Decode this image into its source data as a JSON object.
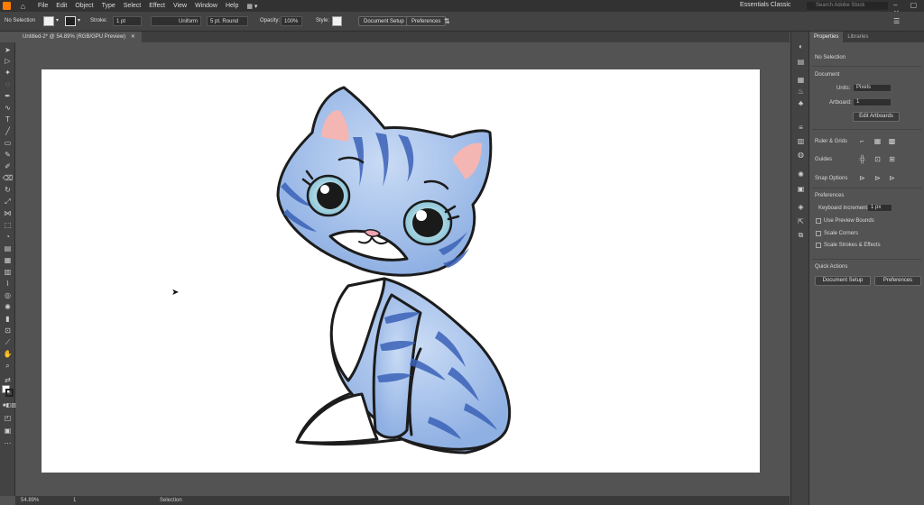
{
  "menubar": {
    "items": [
      "File",
      "Edit",
      "Object",
      "Type",
      "Select",
      "Effect",
      "View",
      "Window",
      "Help"
    ],
    "workspace": "Essentials Classic",
    "search_placeholder": "Search Adobe Stock"
  },
  "control": {
    "selection": "No Selection",
    "stroke_label": "Stroke:",
    "stroke_value": "1 pt",
    "profile": "Uniform",
    "brush": "5 pt. Round",
    "opacity_label": "Opacity:",
    "opacity_value": "100%",
    "style_label": "Style:",
    "doc_setup": "Document Setup",
    "preferences": "Preferences"
  },
  "document": {
    "tab_title": "Untitled-2* @ 54.89% (RGB/GPU Preview)"
  },
  "status": {
    "zoom": "54.89%",
    "artboard": "1",
    "tool": "Selection"
  },
  "panel": {
    "tabs": [
      "Properties",
      "Libraries"
    ],
    "selection": "No Selection",
    "document_header": "Document",
    "units_label": "Units:",
    "units_value": "Pixels",
    "artboard_label": "Artboard:",
    "artboard_value": "1",
    "edit_artboards": "Edit Artboards",
    "ruler_grids": "Ruler & Grids",
    "guides": "Guides",
    "snap_options": "Snap Options",
    "preferences_header": "Preferences",
    "keyboard_increment_label": "Keyboard Increment:",
    "keyboard_increment_value": "1 px",
    "use_preview_bounds": "Use Preview Bounds",
    "scale_corners": "Scale Corners",
    "scale_strokes": "Scale Strokes & Effects",
    "quick_actions": "Quick Actions",
    "doc_setup": "Document Setup",
    "preferences": "Preferences"
  },
  "colors": {
    "cat_blue": "#a7c3ec",
    "cat_stripe": "#3b62b8",
    "ear_pink": "#f3b6b3"
  }
}
